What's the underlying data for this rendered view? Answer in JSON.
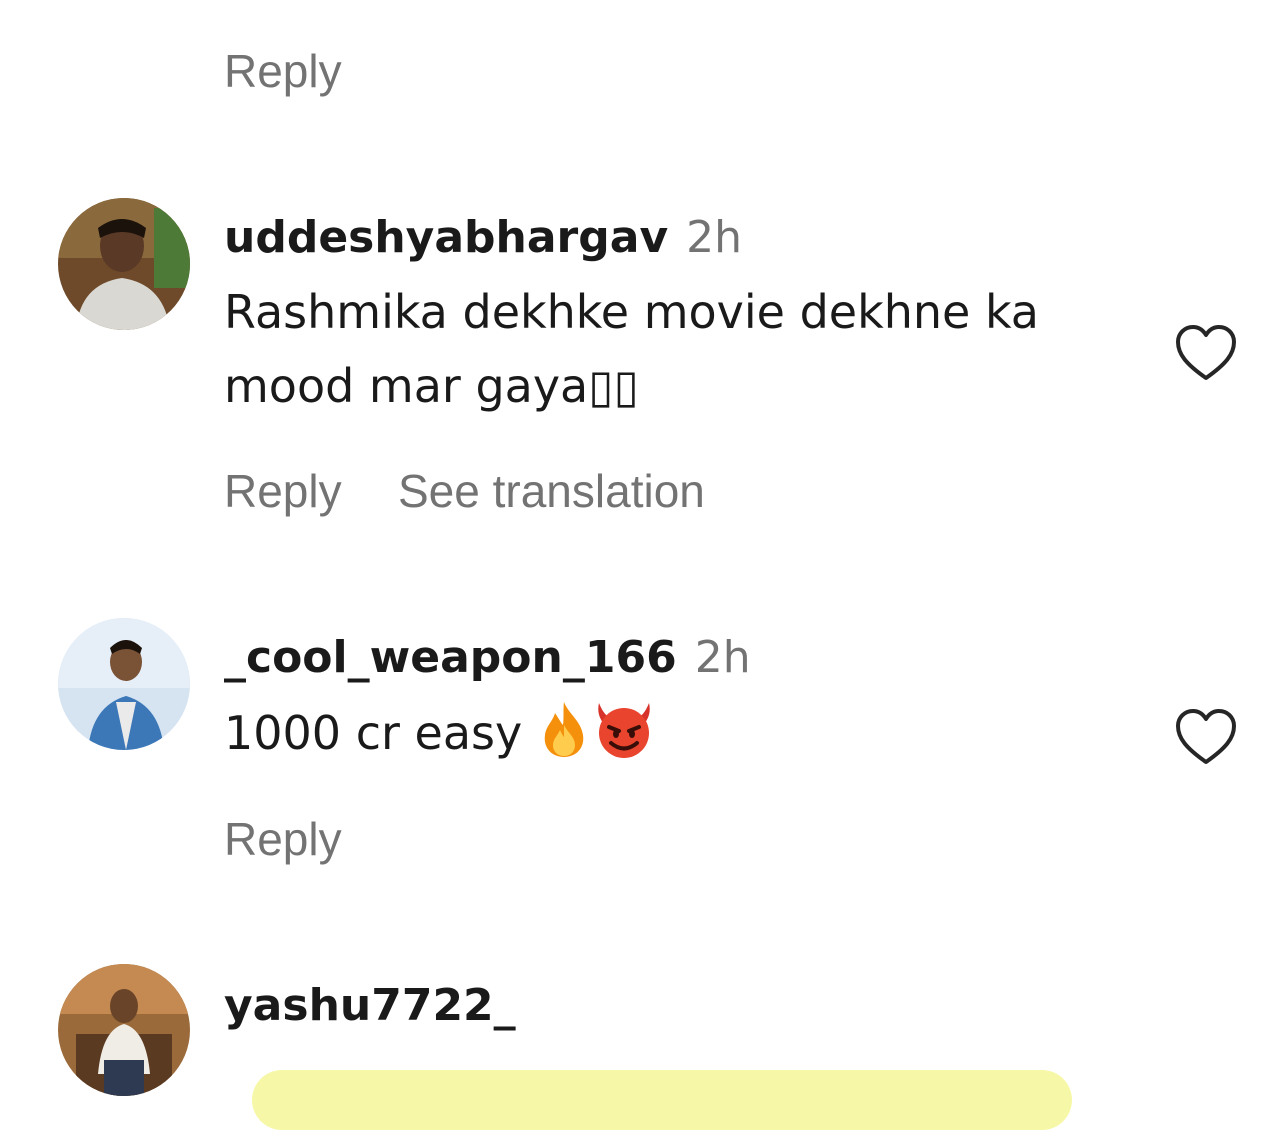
{
  "top_reply": {
    "reply_label": "Reply"
  },
  "comments": [
    {
      "username": "uddeshyabhargav",
      "time": "2h",
      "text_line1": "Rashmika dekhke movie dekhne ka",
      "text_line2": "mood mar gaya▯▯",
      "reply_label": "Reply",
      "translation_label": "See translation",
      "like_icon": "heart-outline-icon"
    },
    {
      "username": "_cool_weapon_166",
      "time": "2h",
      "text": "1000 cr easy",
      "emojis": [
        "fire-emoji",
        "smiling-devil-emoji"
      ],
      "reply_label": "Reply",
      "like_icon": "heart-outline-icon"
    },
    {
      "username": "yashu7722_"
    }
  ],
  "colors": {
    "secondary_text": "#737373",
    "primary_text": "#1a1a1a",
    "input_bar": "#f6f8a8"
  }
}
